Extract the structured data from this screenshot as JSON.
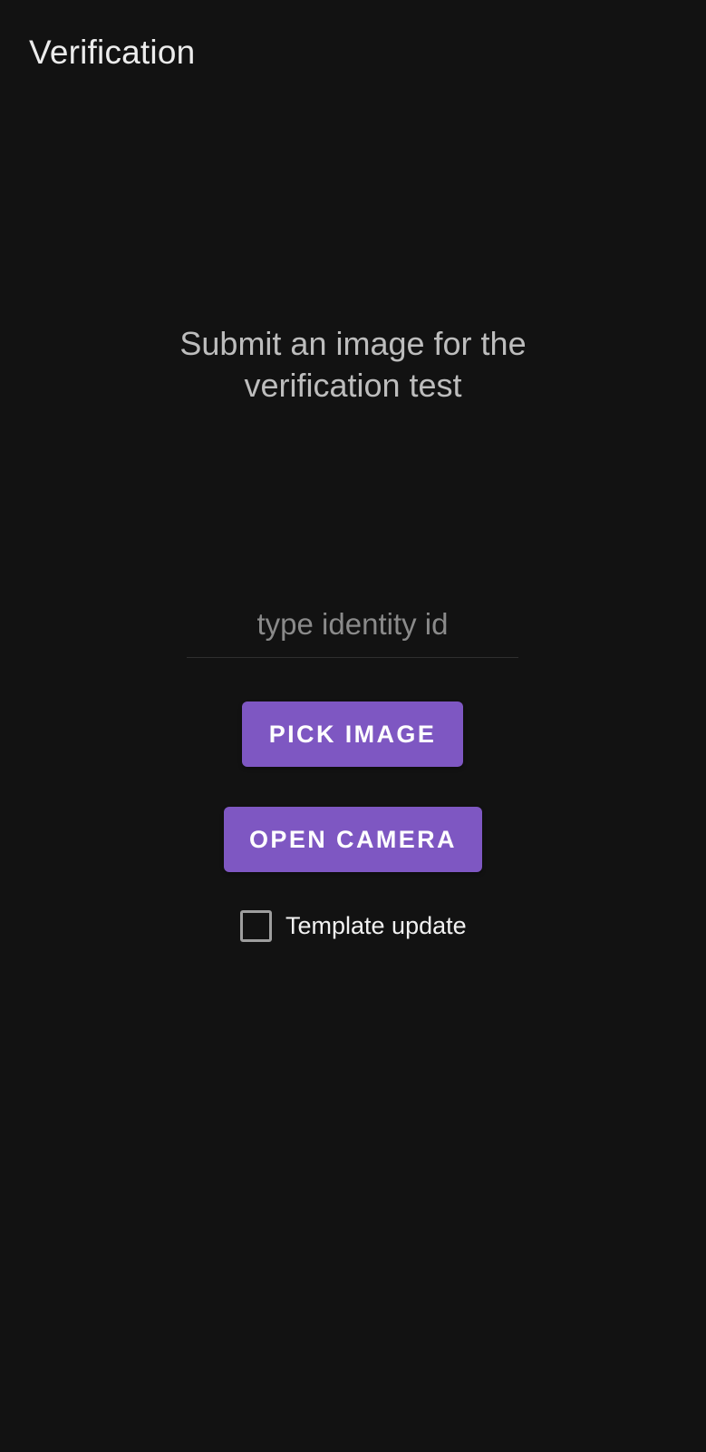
{
  "app_bar": {
    "title": "Verification"
  },
  "main": {
    "instruction_line1": "Submit an image for the",
    "instruction_line2": "verification test",
    "identity_input": {
      "value": "",
      "placeholder": "type identity id"
    },
    "pick_image_label": "PICK IMAGE",
    "open_camera_label": "OPEN CAMERA",
    "template_update": {
      "label": "Template update",
      "checked": false
    }
  },
  "colors": {
    "background": "#121212",
    "accent": "#7e57c2",
    "title_text": "#ececec",
    "secondary_text": "#bdbdbd",
    "hint_text": "#8a8a8a",
    "checkbox_border": "#9e9e9e"
  },
  "icons": {
    "checkbox": "checkbox-unchecked-icon"
  }
}
